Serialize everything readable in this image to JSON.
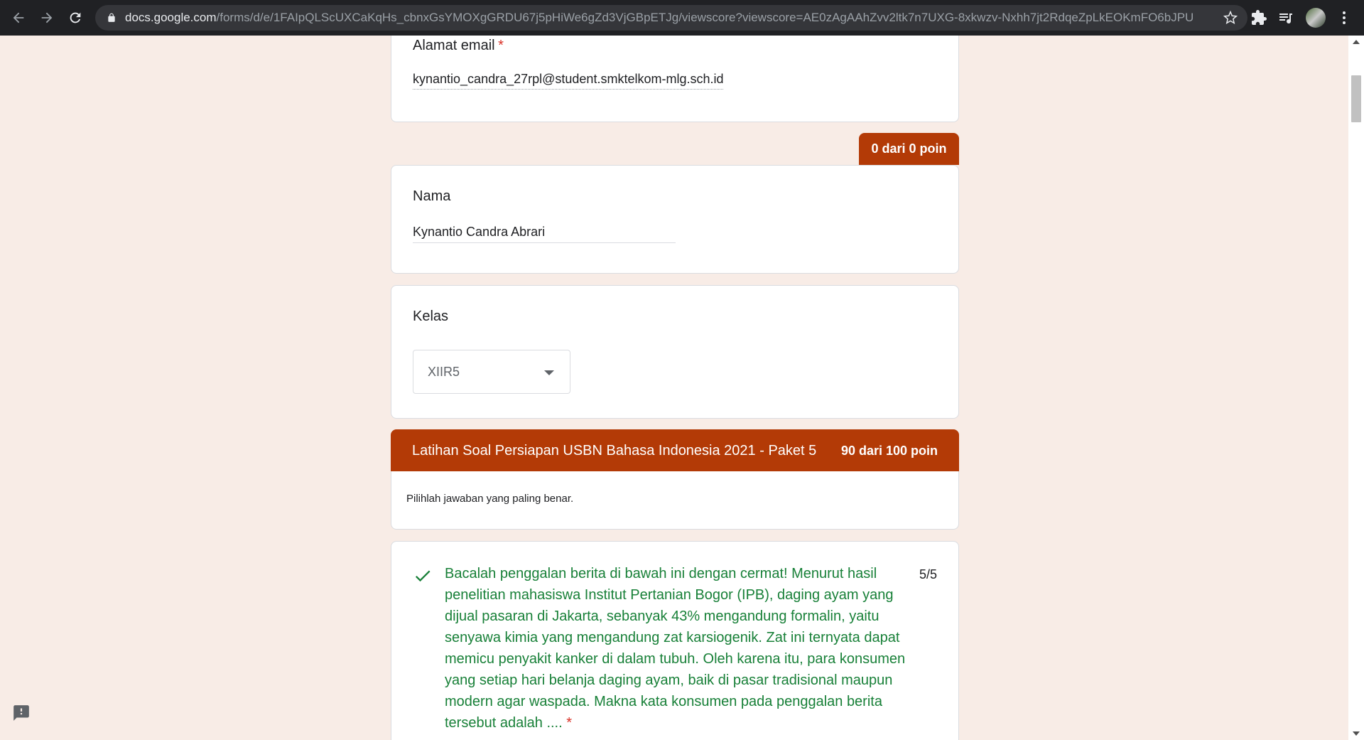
{
  "browser": {
    "url_host": "docs.google.com",
    "url_path": "/forms/d/e/1FAIpQLScUXCaKqHs_cbnxGsYMOXgGRDU67j5pHiWe6gZd3VjGBpETJg/viewscore?viewscore=AE0zAgAAhZvv2ltk7n7UXG-8xkwzv-Nxhh7jt2RdqeZpLkEOKmFO6bJPUI3...",
    "icons": [
      "back-icon",
      "forward-icon",
      "reload-icon",
      "lock-icon",
      "star-icon",
      "extensions-icon",
      "reading-list-icon",
      "menu-icon"
    ]
  },
  "form": {
    "email": {
      "label": "Alamat email",
      "required_mark": "*",
      "value": "kynantio_candra_27rpl@student.smktelkom-mlg.sch.id"
    },
    "top_points": "0 dari 0 poin",
    "nama": {
      "label": "Nama",
      "value": "Kynantio Candra Abrari"
    },
    "kelas": {
      "label": "Kelas",
      "value": "XIIR5"
    },
    "section": {
      "title": "Latihan Soal Persiapan USBN Bahasa Indonesia 2021 - Paket 5",
      "points": "90 dari 100 poin",
      "description": "Pilihlah jawaban yang paling benar."
    },
    "question1": {
      "text": "Bacalah penggalan berita di bawah ini dengan cermat! Menurut hasil penelitian mahasiswa Institut Pertanian Bogor (IPB), daging ayam yang dijual pasaran di Jakarta, sebanyak 43% mengandung formalin, yaitu senyawa kimia yang mengandung zat karsiogenik. Zat ini ternyata dapat memicu penyakit kanker di dalam tubuh. Oleh karena itu, para konsumen yang setiap hari belanja daging ayam, baik di pasar tradisional maupun modern agar waspada. Makna kata konsumen pada penggalan berita tersebut adalah ....",
      "required_mark": "*",
      "score": "5/5",
      "status": "correct"
    }
  },
  "colors": {
    "accent": "#b33a06",
    "background": "#f8ece6",
    "correct": "#188038"
  }
}
